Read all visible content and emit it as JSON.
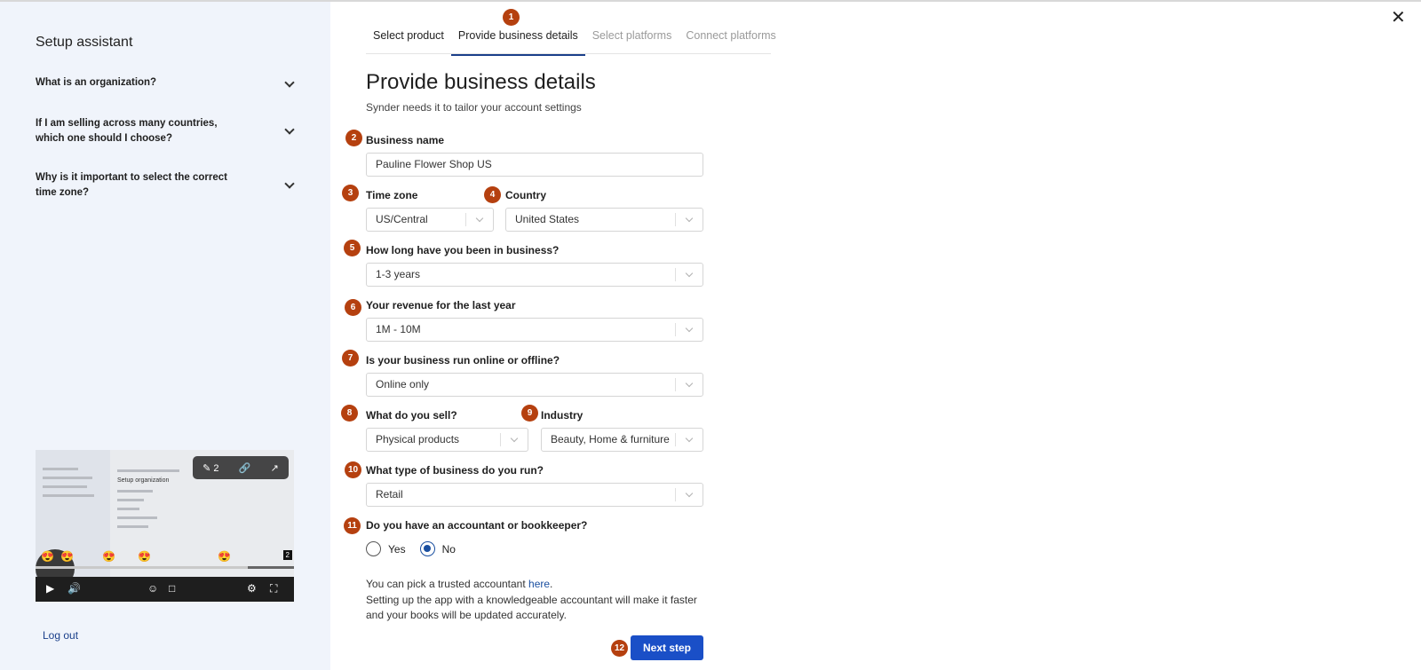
{
  "sidebar": {
    "title": "Setup assistant",
    "faq": [
      {
        "question": "What is an organization?"
      },
      {
        "question": "If I am selling across many countries, which one should I choose?"
      },
      {
        "question": "Why is it important to select the correct time zone?"
      }
    ],
    "video": {
      "comment_count": "2",
      "title": "Setup organization",
      "badge": "2"
    },
    "logout_label": "Log out"
  },
  "steps": [
    {
      "label": "Select product",
      "state": "done"
    },
    {
      "label": "Provide business details",
      "state": "active"
    },
    {
      "label": "Select platforms",
      "state": "disabled"
    },
    {
      "label": "Connect platforms",
      "state": "disabled"
    }
  ],
  "annotations": [
    "1",
    "2",
    "3",
    "4",
    "5",
    "6",
    "7",
    "8",
    "9",
    "10",
    "11",
    "12"
  ],
  "form": {
    "title": "Provide business details",
    "subtitle": "Synder needs it to tailor your account settings",
    "business_name": {
      "label": "Business name",
      "value": "Pauline Flower Shop US"
    },
    "time_zone": {
      "label": "Time zone",
      "value": "US/Central"
    },
    "country": {
      "label": "Country",
      "value": "United States"
    },
    "years": {
      "label": "How long have you been in business?",
      "value": "1-3 years"
    },
    "revenue": {
      "label": "Your revenue for the last year",
      "value": "1M - 10M"
    },
    "online": {
      "label": "Is your business run online or offline?",
      "value": "Online only"
    },
    "sell": {
      "label": "What do you sell?",
      "value": "Physical products"
    },
    "industry": {
      "label": "Industry",
      "value": "Beauty, Home & furniture"
    },
    "type": {
      "label": "What type of business do you run?",
      "value": "Retail"
    },
    "accountant": {
      "label": "Do you have an accountant or bookkeeper?",
      "options": [
        "Yes",
        "No"
      ],
      "selected": "No"
    },
    "info_prefix": "You can pick a trusted accountant ",
    "info_link": "here",
    "info_suffix": ".",
    "info_line2": "Setting up the app with a knowledgeable accountant will make it faster",
    "info_line3": "and your books will be updated accurately.",
    "next_label": "Next step"
  },
  "colors": {
    "sidebar_bg": "#f0f4fb",
    "annotation": "#b5400f",
    "primary_button": "#1a4fc7",
    "link": "#1a4fa0"
  }
}
